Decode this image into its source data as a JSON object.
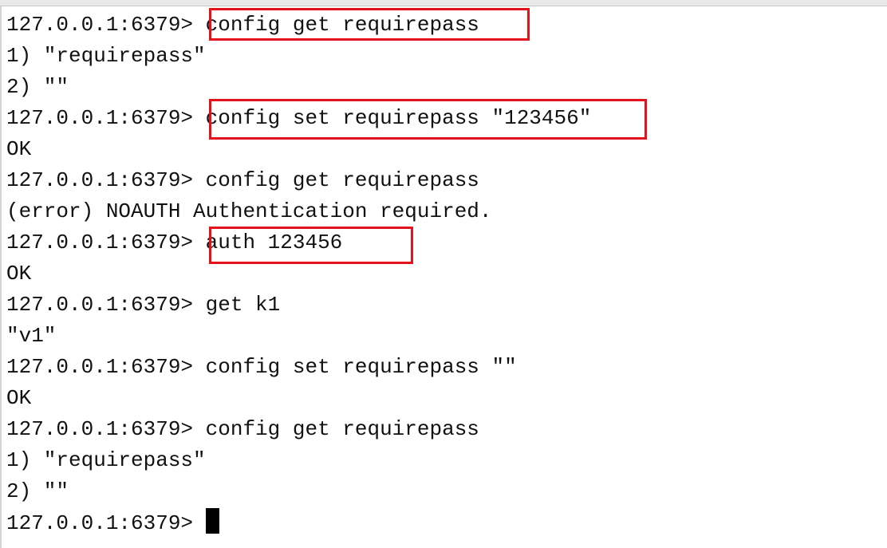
{
  "terminal": {
    "lines": [
      {
        "prompt": "127.0.0.1:6379> ",
        "command": "config get requirepass"
      },
      {
        "output": "1) \"requirepass\""
      },
      {
        "output": "2) \"\""
      },
      {
        "prompt": "127.0.0.1:6379> ",
        "command": "config set requirepass \"123456\""
      },
      {
        "output": "OK"
      },
      {
        "prompt": "127.0.0.1:6379> ",
        "command": "config get requirepass"
      },
      {
        "output": "(error) NOAUTH Authentication required."
      },
      {
        "prompt": "127.0.0.1:6379> ",
        "command": "auth 123456"
      },
      {
        "output": "OK"
      },
      {
        "prompt": "127.0.0.1:6379> ",
        "command": "get k1"
      },
      {
        "output": "\"v1\""
      },
      {
        "prompt": "127.0.0.1:6379> ",
        "command": "config set requirepass \"\""
      },
      {
        "output": "OK"
      },
      {
        "prompt": "127.0.0.1:6379> ",
        "command": "config get requirepass"
      },
      {
        "output": "1) \"requirepass\""
      },
      {
        "output": "2) \"\""
      },
      {
        "prompt": "127.0.0.1:6379> ",
        "command": ""
      }
    ],
    "highlight_color": "#e3121b"
  }
}
